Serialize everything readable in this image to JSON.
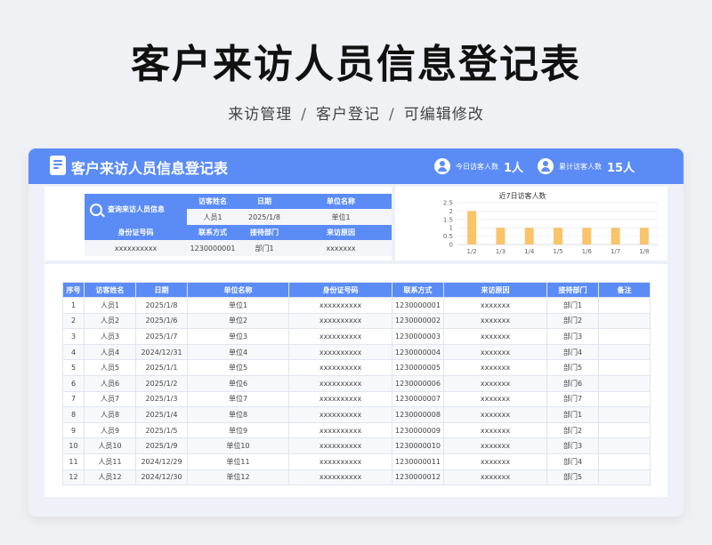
{
  "page": {
    "title": "客户来访人员信息登记表",
    "breadcrumb": [
      "来访管理",
      "客户登记",
      "可编辑修改"
    ],
    "separator": "/"
  },
  "header": {
    "title": "客户来访人员信息登记表",
    "stats": [
      {
        "label": "今日访客人数",
        "value": "1人"
      },
      {
        "label": "累计访客人数",
        "value": "15人"
      }
    ]
  },
  "query": {
    "button_label": "查询来访人员信息",
    "row1_headers": [
      "访客姓名",
      "日期",
      "单位名称"
    ],
    "row1_values": [
      "人员1",
      "2025/1/8",
      "单位1"
    ],
    "row2_headers": [
      "身份证号码",
      "联系方式",
      "接待部门",
      "来访原因"
    ],
    "row2_values": [
      "xxxxxxxxxx",
      "1230000001",
      "部门1",
      "xxxxxxx"
    ]
  },
  "chart_data": {
    "type": "bar",
    "title": "近7日访客人数",
    "categories": [
      "1/2",
      "1/3",
      "1/4",
      "1/5",
      "1/6",
      "1/7",
      "1/8"
    ],
    "values": [
      2,
      1,
      1,
      1,
      1,
      1,
      1
    ],
    "ylim": [
      0,
      2.5
    ],
    "yticks": [
      "0",
      "0.5",
      "1",
      "1.5",
      "2",
      "2.5"
    ],
    "grid": true,
    "bar_color": "#f9c46a"
  },
  "table": {
    "columns": [
      "序号",
      "访客姓名",
      "日期",
      "单位名称",
      "身份证号码",
      "联系方式",
      "来访原因",
      "接待部门",
      "备注"
    ],
    "rows": [
      [
        "1",
        "人员1",
        "2025/1/8",
        "单位1",
        "xxxxxxxxxx",
        "1230000001",
        "xxxxxxx",
        "部门1",
        ""
      ],
      [
        "2",
        "人员2",
        "2025/1/6",
        "单位2",
        "xxxxxxxxxx",
        "1230000002",
        "xxxxxxx",
        "部门2",
        ""
      ],
      [
        "3",
        "人员3",
        "2025/1/7",
        "单位3",
        "xxxxxxxxxx",
        "1230000003",
        "xxxxxxx",
        "部门3",
        ""
      ],
      [
        "4",
        "人员4",
        "2024/12/31",
        "单位4",
        "xxxxxxxxxx",
        "1230000004",
        "xxxxxxx",
        "部门4",
        ""
      ],
      [
        "5",
        "人员5",
        "2025/1/1",
        "单位5",
        "xxxxxxxxxx",
        "1230000005",
        "xxxxxxx",
        "部门5",
        ""
      ],
      [
        "6",
        "人员6",
        "2025/1/2",
        "单位6",
        "xxxxxxxxxx",
        "1230000006",
        "xxxxxxx",
        "部门6",
        ""
      ],
      [
        "7",
        "人员7",
        "2025/1/3",
        "单位7",
        "xxxxxxxxxx",
        "1230000007",
        "xxxxxxx",
        "部门7",
        ""
      ],
      [
        "8",
        "人员8",
        "2025/1/4",
        "单位8",
        "xxxxxxxxxx",
        "1230000008",
        "xxxxxxx",
        "部门1",
        ""
      ],
      [
        "9",
        "人员9",
        "2025/1/5",
        "单位9",
        "xxxxxxxxxx",
        "1230000009",
        "xxxxxxx",
        "部门2",
        ""
      ],
      [
        "10",
        "人员10",
        "2025/1/9",
        "单位10",
        "xxxxxxxxxx",
        "1230000010",
        "xxxxxxx",
        "部门3",
        ""
      ],
      [
        "11",
        "人员11",
        "2024/12/29",
        "单位11",
        "xxxxxxxxxx",
        "1230000011",
        "xxxxxxx",
        "部门4",
        ""
      ],
      [
        "12",
        "人员12",
        "2024/12/30",
        "单位12",
        "xxxxxxxxxx",
        "1230000012",
        "xxxxxxx",
        "部门5",
        ""
      ]
    ]
  },
  "colors": {
    "accent": "#5b8cf6",
    "bar": "#f9c46a"
  }
}
